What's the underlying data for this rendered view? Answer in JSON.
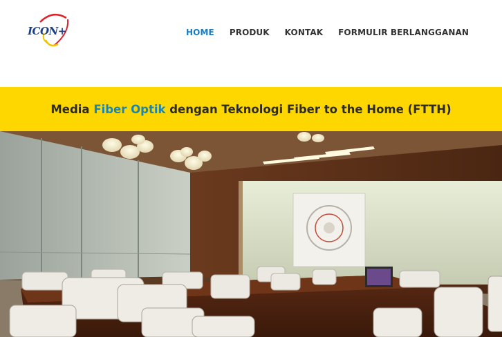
{
  "header": {
    "logo_text": "ICON+",
    "nav": [
      {
        "label": "HOME",
        "active": true
      },
      {
        "label": "PRODUK",
        "active": false
      },
      {
        "label": "KONTAK",
        "active": false
      },
      {
        "label": "FORMULIR BERLANGGANAN",
        "active": false
      }
    ]
  },
  "banner": {
    "text_before": "Media ",
    "text_highlight": "Fiber Optik",
    "text_after": " dengan Teknologi Fiber to the Home (FTTH)",
    "background": "#fed700",
    "highlight_color": "#1a86b6"
  },
  "hero_image": {
    "icon": "meeting-room-photo"
  },
  "colors": {
    "nav_active": "#1a7bbd",
    "nav_default": "#333333",
    "logo_blue": "#1a3f8f",
    "logo_red": "#d8232a",
    "logo_yellow": "#f3c300"
  }
}
